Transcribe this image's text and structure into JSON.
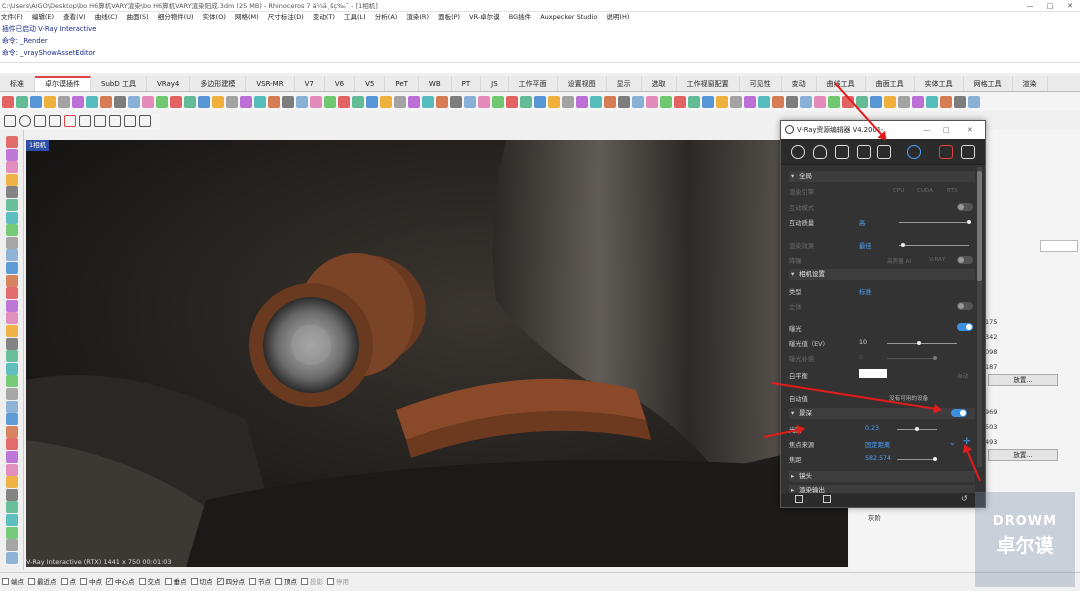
{
  "window": {
    "title": "C:\\Users\\AIGO\\Desktop\\bo H6算机VARY渲染\\bo H6算机VARY渲染阳成.3dm (25 MB) - Rhinoceros 7 ä¼ä¸šç‰ˆ - [1相机]",
    "controls": [
      "—",
      "□",
      "✕"
    ]
  },
  "menu": [
    "文件(F)",
    "编辑(E)",
    "查看(V)",
    "曲线(C)",
    "曲面(S)",
    "细分物件(U)",
    "实体(O)",
    "网格(M)",
    "尺寸标注(D)",
    "变动(T)",
    "工具(L)",
    "分析(A)",
    "渲染(R)",
    "面板(P)",
    "VR-卓尔谟",
    "BG插件",
    "Auxpecker Studio",
    "说明(H)"
  ],
  "command_history": [
    "插件已启动 V-Ray Interactive",
    "命令: _Render",
    "命令: _vrayShowAssetEditor"
  ],
  "tabs": [
    "标准",
    "卓尔谟插件",
    "SubD 工具",
    "VRay4",
    "多边形建模",
    "VSR-MR",
    "V7",
    "V6",
    "V5",
    "PeT",
    "WB",
    "PT",
    "JS",
    "工作平面",
    "设置视图",
    "显示",
    "选取",
    "工作视窗配置",
    "可见性",
    "变动",
    "曲线工具",
    "曲面工具",
    "实体工具",
    "网格工具",
    "渲染"
  ],
  "viewport": {
    "label": "1相机",
    "status": "V-Ray Interactive (RTX)   1441 x 750    00:01:03"
  },
  "status_bar": [
    {
      "label": "端点",
      "checked": false
    },
    {
      "label": "最近点",
      "checked": false
    },
    {
      "label": "点",
      "checked": false
    },
    {
      "label": "中点",
      "checked": false
    },
    {
      "label": "中心点",
      "checked": true
    },
    {
      "label": "交点",
      "checked": false
    },
    {
      "label": "垂点",
      "checked": false
    },
    {
      "label": "切点",
      "checked": false
    },
    {
      "label": "四分点",
      "checked": true
    },
    {
      "label": "节点",
      "checked": false
    },
    {
      "label": "顶点",
      "checked": false
    },
    {
      "label": "投影",
      "checked": false
    },
    {
      "label": "停用",
      "checked": false
    }
  ],
  "right_panel": {
    "values": [
      "175",
      "342",
      "098",
      "187",
      "969",
      "503",
      "493"
    ],
    "button_label": "放置...",
    "row_label": "灰阶"
  },
  "vray_editor": {
    "title": "V-Ray资源编辑器 V4.2001-",
    "sections": {
      "global": "全局",
      "camera": "相机设置",
      "dof": "景深",
      "lens": "镜头",
      "render_output": "渲染输出"
    },
    "rows": {
      "render_engine": "渲染引擎",
      "engine_options": [
        "CPU",
        "CUDA",
        "RTX"
      ],
      "interactive": "互动模式",
      "progressive": "互动质量",
      "progressive_val": "高",
      "denoise": "渲染效果",
      "denoise_val": "最佳",
      "noise_limit": "降噪",
      "denoise_opts": [
        "高质量 AI",
        "V-RAY"
      ],
      "cam_type": "类型",
      "cam_type_val": "标准",
      "stereo": "立体",
      "exposure": "曝光",
      "exposure_ev": "曝光值（EV）",
      "exposure_ev_val": "10",
      "exposure_comp": "曝光补偿",
      "exposure_comp_val": "0",
      "white_balance": "白平衡",
      "auto_text": "自动",
      "auto_balance": "自动值",
      "no_device": "没有可用的设备",
      "dof_label": "景深",
      "aperture": "光圈",
      "aperture_val": "0.23",
      "focus_source": "焦点来源",
      "focus_source_val": "固定距离",
      "focus_dist": "焦距",
      "focus_dist_val": "582.574"
    }
  },
  "watermark": {
    "en": "DROWM",
    "cn": "卓尔谟"
  },
  "colors": {
    "accent_blue": "#3b8fe0",
    "arrow_red": "#e21b1b",
    "dialog_bg": "#333333"
  }
}
